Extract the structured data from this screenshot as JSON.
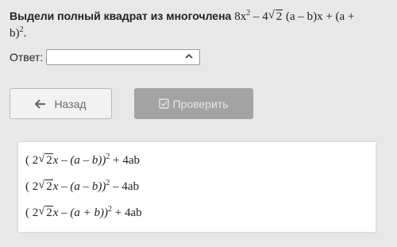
{
  "question": {
    "label": "Выдели полный квадрат из многочлена",
    "expr_part1": "8x",
    "exp2": "2",
    "expr_part2": " – 4",
    "sqrt_arg": "2",
    "expr_part3": " (a – b)x + (a +",
    "expr_part4": "b)",
    "expr_end": "."
  },
  "answer": {
    "label": "Ответ:",
    "value": ""
  },
  "buttons": {
    "back_label": "Назад",
    "check_label": "Проверить"
  },
  "options": [
    {
      "pre": "( 2",
      "sqrt_arg": "2",
      "mid": "x – (a – b))",
      "exp": "2",
      "post": " + 4ab"
    },
    {
      "pre": "( 2",
      "sqrt_arg": "2",
      "mid": "x – (a – b))",
      "exp": "2",
      "post": " – 4ab"
    },
    {
      "pre": "( 2",
      "sqrt_arg": "2",
      "mid": "x – (a + b))",
      "exp": "2",
      "post": " + 4ab"
    }
  ],
  "colors": {
    "background": "#e8e8e8",
    "check_button": "#a3a3a3",
    "back_button_text": "#6a6a6a"
  },
  "icons": [
    "arrow-left-icon",
    "checkbox-check-icon",
    "chevron-up-icon"
  ]
}
